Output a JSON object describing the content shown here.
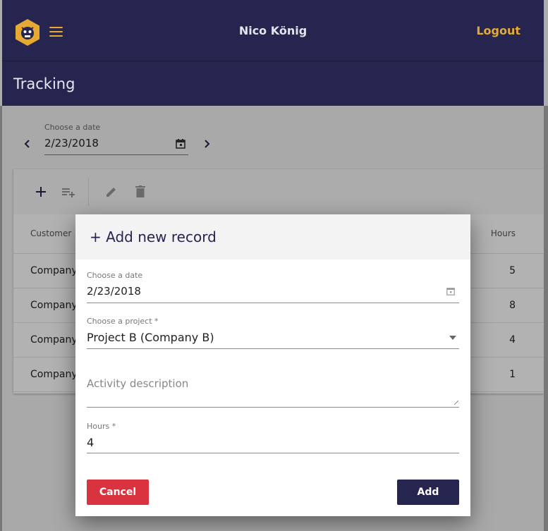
{
  "header": {
    "user_name": "Nico König",
    "logout_label": "Logout",
    "page_title": "Tracking"
  },
  "date_chooser": {
    "label": "Choose a date",
    "value": "2/23/2018"
  },
  "table": {
    "columns": {
      "customer": "Customer",
      "hours": "Hours"
    },
    "rows": [
      {
        "customer": "Company",
        "hours": "5"
      },
      {
        "customer": "Company",
        "hours": "8"
      },
      {
        "customer": "Company",
        "hours": "4"
      },
      {
        "customer": "Company",
        "hours": "1"
      }
    ]
  },
  "dialog": {
    "title": "Add new record",
    "date_label": "Choose a date",
    "date_value": "2/23/2018",
    "project_label": "Choose a project *",
    "project_value": "Project B (Company B)",
    "description_placeholder": "Activity description",
    "hours_label": "Hours *",
    "hours_value": "4",
    "cancel_label": "Cancel",
    "add_label": "Add"
  },
  "colors": {
    "primary": "#25254f",
    "accent": "#e6a933",
    "danger": "#d9333f"
  }
}
